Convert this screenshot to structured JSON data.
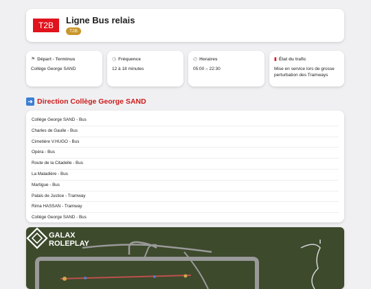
{
  "header": {
    "line_code": "T2B",
    "title": "Ligne Bus relais",
    "badge": "T2B",
    "logo_color": "#e1131c",
    "badge_color": "#c9962a"
  },
  "info_cards": [
    {
      "icon": "signpost-icon",
      "glyph": "⚑",
      "label": "Départ - Terminus",
      "value": "Collège George SAND"
    },
    {
      "icon": "stopwatch-icon",
      "glyph": "◷",
      "label": "Fréquence",
      "value": "12 à 18 minutes"
    },
    {
      "icon": "clock-icon",
      "glyph": "◴",
      "label": "Horaires",
      "value": "05:00 – 22:30"
    },
    {
      "icon": "traffic-light-icon",
      "glyph": "▮",
      "label": "État du trafic",
      "value": "Mise en service lors de grosse perturbation des Tramways"
    }
  ],
  "direction": {
    "icon": "arrow-right-icon",
    "label": "Direction Collège George SAND",
    "color": "#cc1a1a"
  },
  "stops": [
    "Collège George SAND - Bus",
    "Charles de Gaulle - Bus",
    "Cimetière V.HUGO - Bus",
    "Opéra - Bus",
    "Route de la Citadelle - Bus",
    "La Maladière - Bus",
    "Martigue - Bus",
    "Palais de Justice - Tramway",
    "Rima HASSAN - Tramway",
    "Collège George SAND - Bus"
  ],
  "map": {
    "brand_line1": "GALAX",
    "brand_line2": "ROLEPLAY",
    "background": "#3d4a2c"
  }
}
